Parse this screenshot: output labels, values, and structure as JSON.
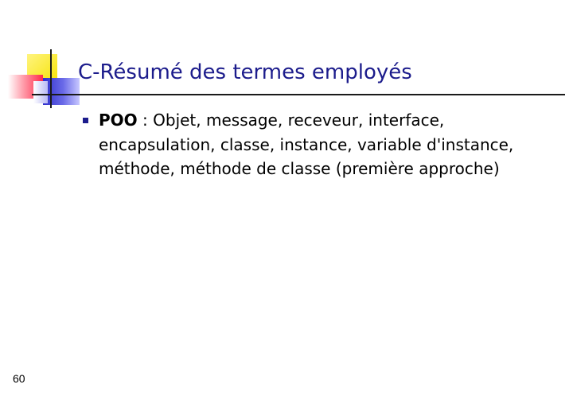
{
  "slide": {
    "title": "C-Résumé des termes employés",
    "bullets": [
      {
        "term": "POO",
        "text": " : Objet, message, receveur, interface, encapsulation, classe, instance, variable d'instance, méthode, méthode de classe (première approche)"
      }
    ],
    "page_number": "60"
  },
  "colors": {
    "title": "#1c1c8c",
    "bullet": "#1c1c8c",
    "yellow": "#f6e200",
    "red": "#ff2a4a",
    "blue": "#2f2fcc"
  }
}
